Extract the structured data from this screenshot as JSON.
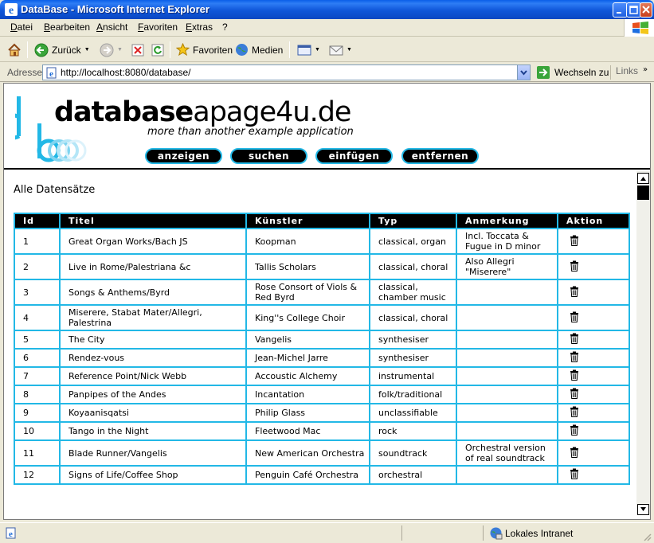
{
  "window": {
    "title": "DataBase - Microsoft Internet Explorer"
  },
  "menu": {
    "items": [
      "Datei",
      "Bearbeiten",
      "Ansicht",
      "Favoriten",
      "Extras",
      "?"
    ]
  },
  "toolbar": {
    "back_label": "Zurück",
    "favorites_label": "Favoriten",
    "media_label": "Medien"
  },
  "address": {
    "label": "Adresse",
    "url": "http://localhost:8080/database/",
    "go_label": "Wechseln zu",
    "links_label": "Links"
  },
  "page": {
    "brand_bold": "database",
    "brand_rest": "apage4u.de",
    "tagline": "more than another example application",
    "nav": [
      "anzeigen",
      "suchen",
      "einfügen",
      "entfernen"
    ],
    "heading": "Alle Datensätze",
    "accent_color": "#22b8e6"
  },
  "table": {
    "headers": [
      "Id",
      "Titel",
      "Künstler",
      "Typ",
      "Anmerkung",
      "Aktion"
    ],
    "rows": [
      {
        "id": "1",
        "titel": "Great Organ Works/Bach JS",
        "kuenstler": "Koopman",
        "typ": "classical, organ",
        "anmerkung": "Incl. Toccata & Fugue in D minor"
      },
      {
        "id": "2",
        "titel": "Live in Rome/Palestriana &c",
        "kuenstler": "Tallis Scholars",
        "typ": "classical, choral",
        "anmerkung": "Also Allegri \"Miserere\""
      },
      {
        "id": "3",
        "titel": "Songs & Anthems/Byrd",
        "kuenstler": "Rose Consort of Viols & Red Byrd",
        "typ": "classical, chamber music",
        "anmerkung": ""
      },
      {
        "id": "4",
        "titel": "Miserere, Stabat Mater/Allegri, Palestrina",
        "kuenstler": "King''s College Choir",
        "typ": "classical, choral",
        "anmerkung": ""
      },
      {
        "id": "5",
        "titel": "The City",
        "kuenstler": "Vangelis",
        "typ": "synthesiser",
        "anmerkung": ""
      },
      {
        "id": "6",
        "titel": "Rendez-vous",
        "kuenstler": "Jean-Michel Jarre",
        "typ": "synthesiser",
        "anmerkung": ""
      },
      {
        "id": "7",
        "titel": "Reference Point/Nick Webb",
        "kuenstler": "Accoustic Alchemy",
        "typ": "instrumental",
        "anmerkung": ""
      },
      {
        "id": "8",
        "titel": "Panpipes of the Andes",
        "kuenstler": "Incantation",
        "typ": "folk/traditional",
        "anmerkung": ""
      },
      {
        "id": "9",
        "titel": "Koyaanisqatsi",
        "kuenstler": "Philip Glass",
        "typ": "unclassifiable",
        "anmerkung": ""
      },
      {
        "id": "10",
        "titel": "Tango in the Night",
        "kuenstler": "Fleetwood Mac",
        "typ": "rock",
        "anmerkung": ""
      },
      {
        "id": "11",
        "titel": "Blade Runner/Vangelis",
        "kuenstler": "New American Orchestra",
        "typ": "soundtrack",
        "anmerkung": "Orchestral version of real soundtrack"
      },
      {
        "id": "12",
        "titel": "Signs of Life/Coffee Shop",
        "kuenstler": "Penguin Café Orchestra",
        "typ": "orchestral",
        "anmerkung": ""
      }
    ]
  },
  "status": {
    "zone": "Lokales Intranet"
  }
}
